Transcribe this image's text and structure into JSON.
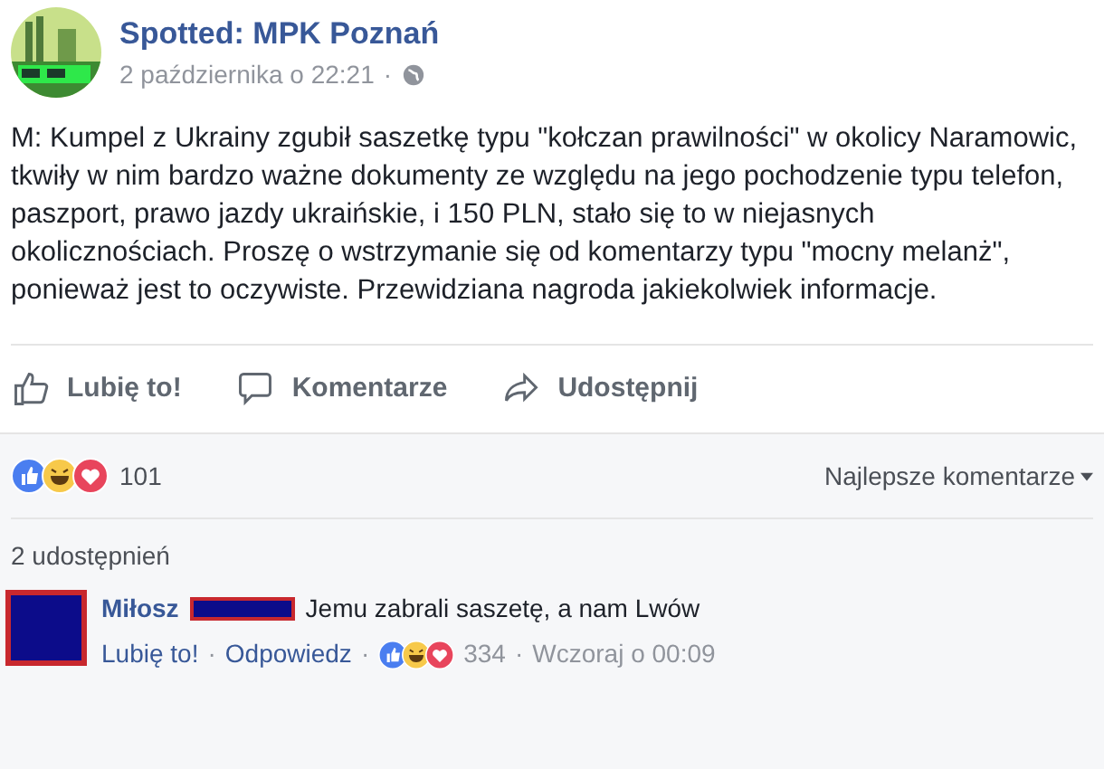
{
  "post": {
    "author": "Spotted: MPK Poznań",
    "time": "2 października o 22:21",
    "separator": "·",
    "text": "M: Kumpel z Ukrainy zgubił saszetkę typu \"kołczan prawilności\" w okolicy Naramowic, tkwiły w nim bardzo ważne dokumenty ze względu na jego pochodzenie typu telefon, paszport, prawo jazdy ukraińskie, i 150 PLN, stało się to w niejasnych okolicznościach. Proszę o wstrzymanie się od komentarzy typu \"mocny melanż\", ponieważ jest to oczywiste. Przewidziana nagroda jakiekolwiek informacje."
  },
  "actions": [
    {
      "kind": "like",
      "label": "Lubię to!"
    },
    {
      "kind": "comment",
      "label": "Komentarze"
    },
    {
      "kind": "share",
      "label": "Udostępnij"
    }
  ],
  "reactions": {
    "count": "101",
    "sort": "Najlepsze komentarze"
  },
  "shares": "2 udostępnień",
  "comment": {
    "author": "Miłosz",
    "text": "Jemu zabrali saszetę, a nam Lwów",
    "like": "Lubię to!",
    "reply": "Odpowiedz",
    "separator": "·",
    "reactions_count": "334",
    "time": "Wczoraj o 00:09"
  }
}
